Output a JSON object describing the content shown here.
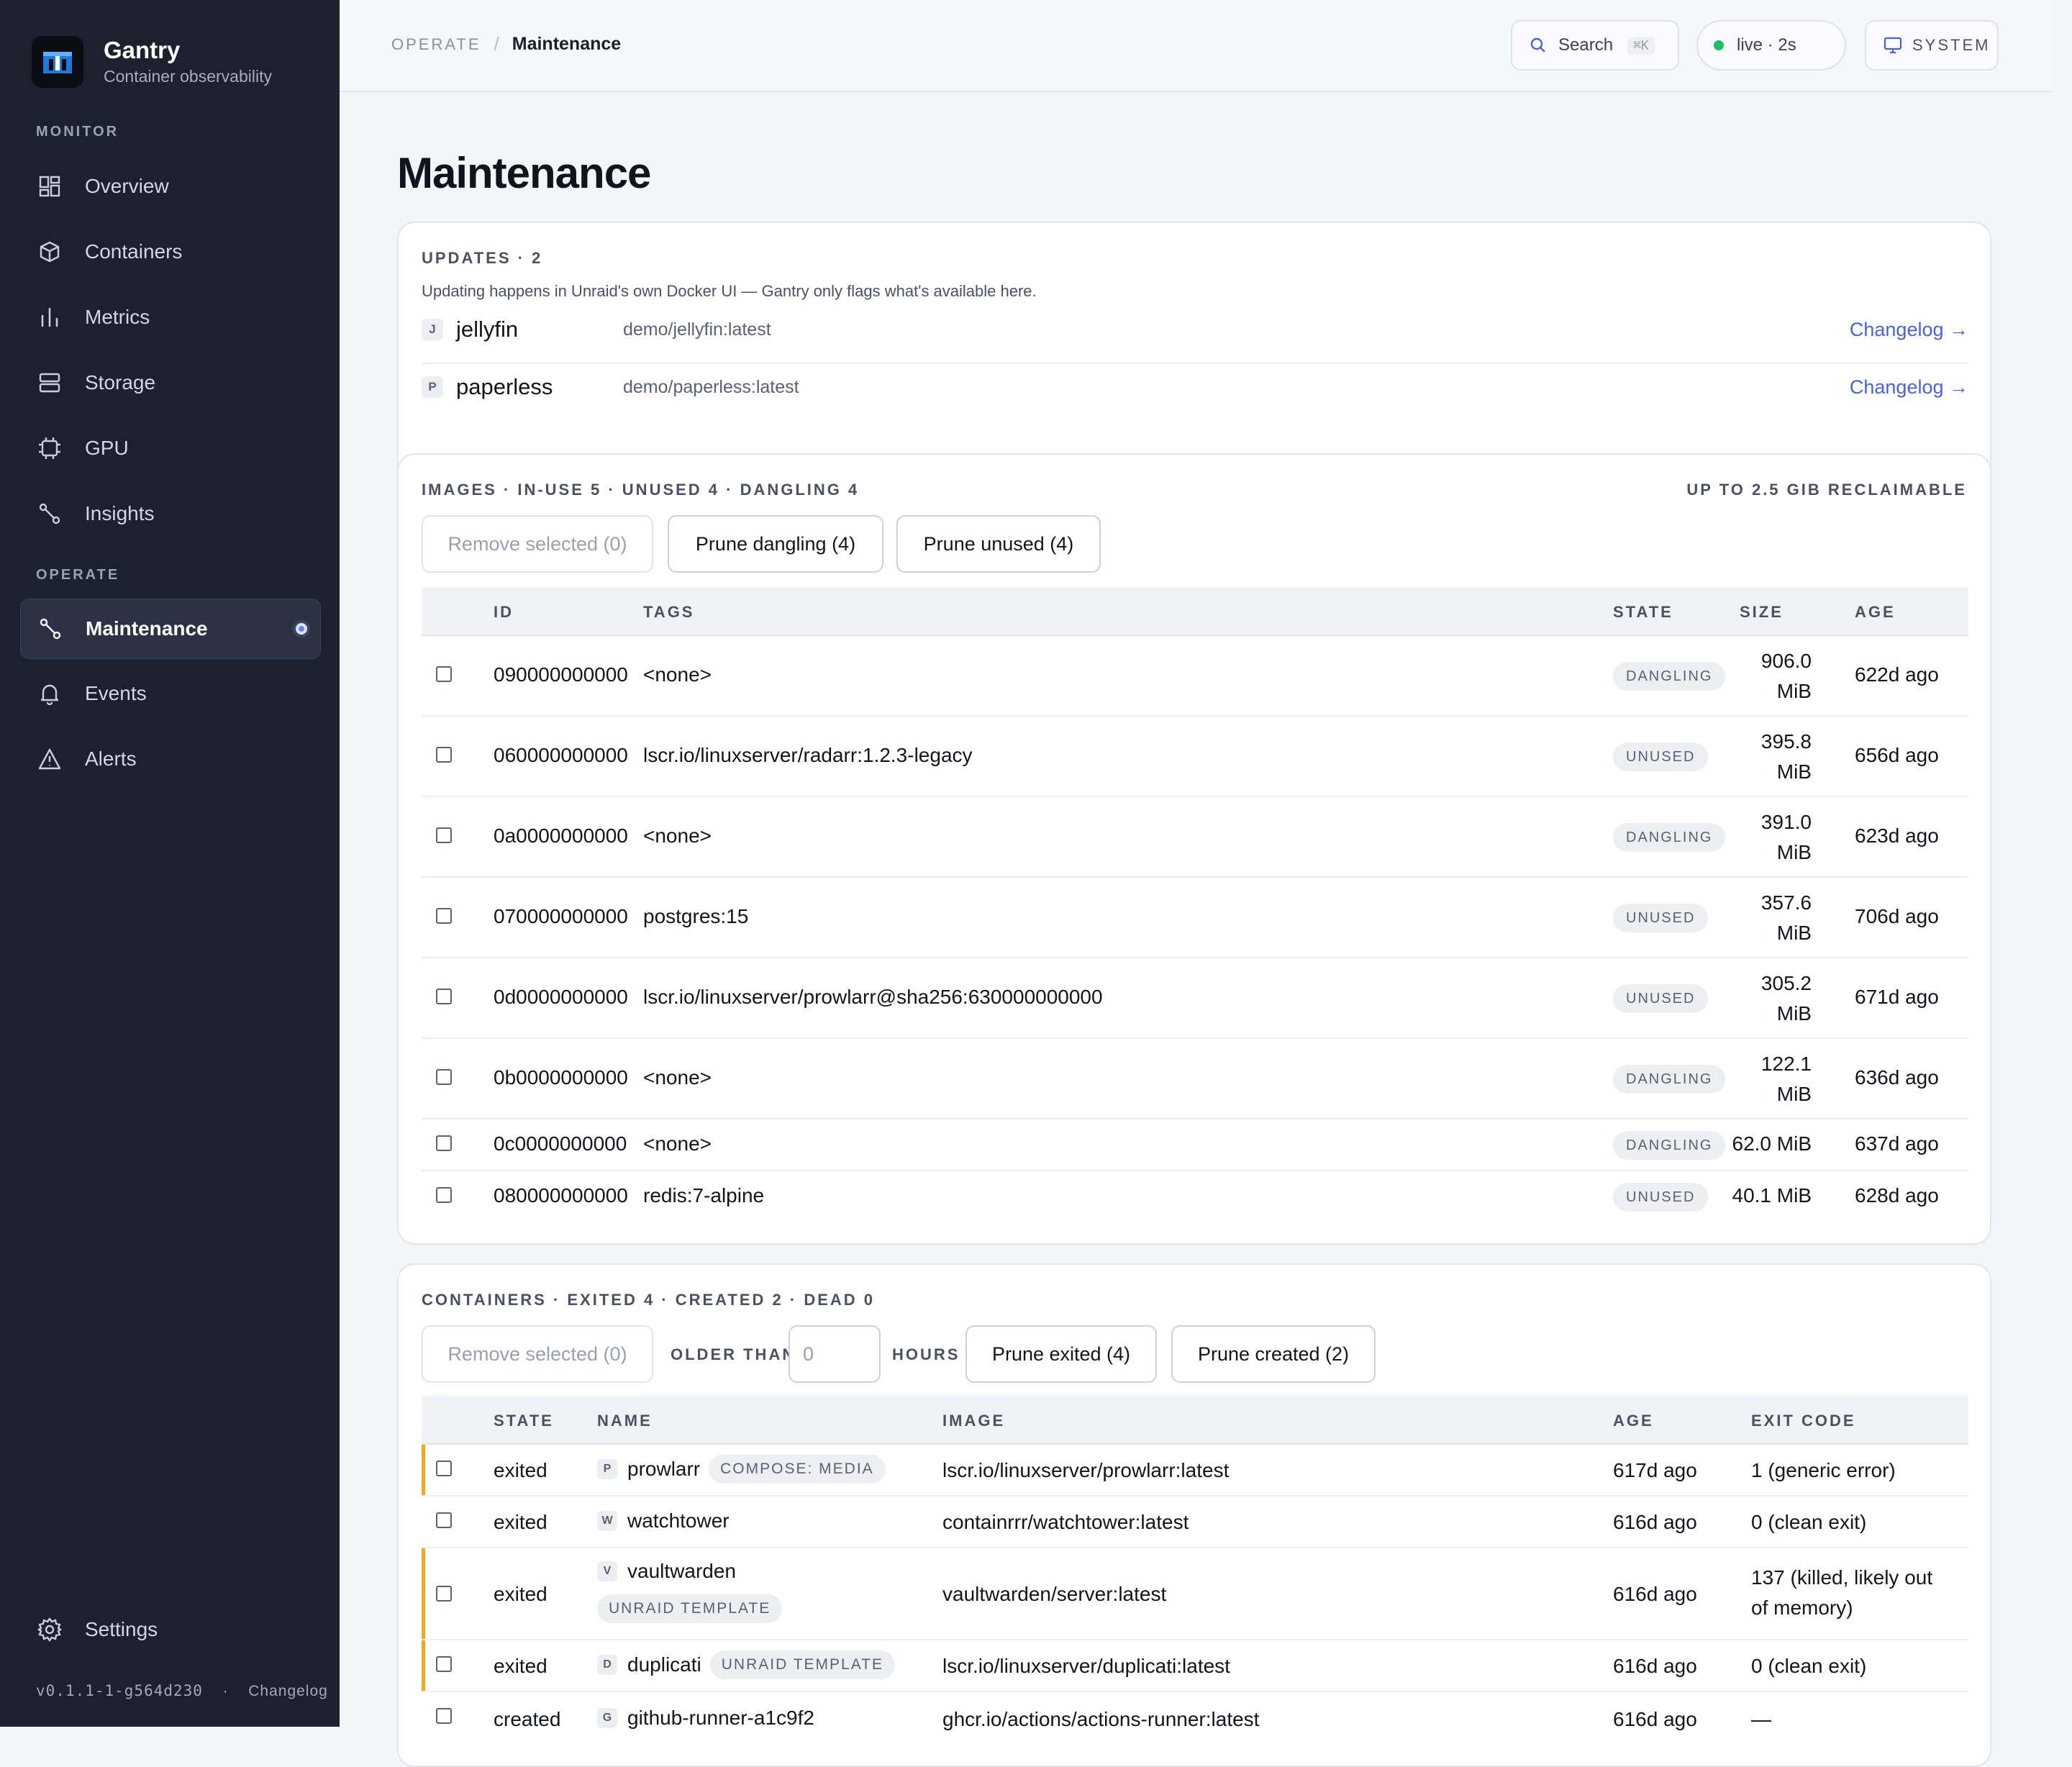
{
  "sidebar": {
    "brand_name": "Gantry",
    "brand_sub": "Container observability",
    "monitor_label": "MONITOR",
    "operate_label": "OPERATE",
    "items": [
      {
        "label": "Overview",
        "icon": "grid-icon"
      },
      {
        "label": "Containers",
        "icon": "cube-icon"
      },
      {
        "label": "Metrics",
        "icon": "bar-chart-icon"
      },
      {
        "label": "Storage",
        "icon": "storage-icon"
      },
      {
        "label": "GPU",
        "icon": "chip-icon"
      },
      {
        "label": "Insights",
        "icon": "route-icon"
      },
      {
        "label": "Maintenance",
        "icon": "route-icon",
        "active": true
      },
      {
        "label": "Events",
        "icon": "bell-icon"
      },
      {
        "label": "Alerts",
        "icon": "warning-icon"
      }
    ],
    "settings_label": "Settings",
    "version": "v0.1.1-1-g564d230",
    "footer_sep": "·",
    "footer_changelog": "Changelog"
  },
  "topbar": {
    "crumb_root": "OPERATE",
    "crumb_sep": "/",
    "crumb_current": "Maintenance",
    "search_label": "Search",
    "search_kbd": "⌘K",
    "live_label": "live · 2s",
    "system_label": "SYSTEM"
  },
  "page": {
    "title": "Maintenance"
  },
  "updates": {
    "heading": "UPDATES · 2",
    "note": "Updating happens in Unraid's own Docker UI — Gantry only flags what's available here.",
    "rows": [
      {
        "letter": "J",
        "name": "jellyfin",
        "image": "demo/jellyfin:latest",
        "link": "Changelog →"
      },
      {
        "letter": "P",
        "name": "paperless",
        "image": "demo/paperless:latest",
        "link": "Changelog →"
      }
    ]
  },
  "images": {
    "heading": "IMAGES · IN-USE 5 · UNUSED 4 · DANGLING 4",
    "reclaim": "UP TO 2.5 GIB RECLAIMABLE",
    "btn_remove": "Remove selected (0)",
    "btn_prune_dangling": "Prune dangling (4)",
    "btn_prune_unused": "Prune unused (4)",
    "columns": {
      "id": "ID",
      "tags": "TAGS",
      "state": "STATE",
      "size": "SIZE",
      "age": "AGE"
    },
    "rows": [
      {
        "id": "090000000000",
        "tags": "<none>",
        "state": "DANGLING",
        "size_a": "906.0",
        "size_b": "MiB",
        "age": "622d ago"
      },
      {
        "id": "060000000000",
        "tags": "lscr.io/linuxserver/radarr:1.2.3-legacy",
        "state": "UNUSED",
        "size_a": "395.8",
        "size_b": "MiB",
        "age": "656d ago"
      },
      {
        "id": "0a0000000000",
        "tags": "<none>",
        "state": "DANGLING",
        "size_a": "391.0",
        "size_b": "MiB",
        "age": "623d ago"
      },
      {
        "id": "070000000000",
        "tags": "postgres:15",
        "state": "UNUSED",
        "size_a": "357.6",
        "size_b": "MiB",
        "age": "706d ago"
      },
      {
        "id": "0d0000000000",
        "tags": "lscr.io/linuxserver/prowlarr@sha256:630000000000",
        "state": "UNUSED",
        "size_a": "305.2",
        "size_b": "MiB",
        "age": "671d ago"
      },
      {
        "id": "0b0000000000",
        "tags": "<none>",
        "state": "DANGLING",
        "size_a": "122.1",
        "size_b": "MiB",
        "age": "636d ago"
      },
      {
        "id": "0c0000000000",
        "tags": "<none>",
        "state": "DANGLING",
        "size_a": "62.0 MiB",
        "size_b": "",
        "age": "637d ago"
      },
      {
        "id": "080000000000",
        "tags": "redis:7-alpine",
        "state": "UNUSED",
        "size_a": "40.1 MiB",
        "size_b": "",
        "age": "628d ago"
      }
    ]
  },
  "containers": {
    "heading": "CONTAINERS · EXITED 4 · CREATED 2 · DEAD 0",
    "btn_remove": "Remove selected (0)",
    "older_than": "OLDER THAN",
    "hours_placeholder": "0",
    "hours": "HOURS",
    "btn_prune_exited": "Prune exited (4)",
    "btn_prune_created": "Prune created (2)",
    "columns": {
      "state": "STATE",
      "name": "NAME",
      "image": "IMAGE",
      "age": "AGE",
      "exit": "EXIT CODE"
    },
    "rows": [
      {
        "state": "exited",
        "letter": "P",
        "name": "prowlarr",
        "tag": "COMPOSE: MEDIA",
        "image": "lscr.io/linuxserver/prowlarr:latest",
        "age": "617d ago",
        "exit": "1 (generic error)"
      },
      {
        "state": "exited",
        "letter": "W",
        "name": "watchtower",
        "tag": "",
        "image": "containrrr/watchtower:latest",
        "age": "616d ago",
        "exit": "0 (clean exit)"
      },
      {
        "state": "exited",
        "letter": "V",
        "name": "vaultwarden",
        "tag": "UNRAID TEMPLATE",
        "image": "vaultwarden/server:latest",
        "age": "616d ago",
        "exit_a": "137 (killed, likely out",
        "exit_b": "of memory)"
      },
      {
        "state": "exited",
        "letter": "D",
        "name": "duplicati",
        "tag": "UNRAID TEMPLATE",
        "image": "lscr.io/linuxserver/duplicati:latest",
        "age": "616d ago",
        "exit": "0 (clean exit)"
      },
      {
        "state": "created",
        "letter": "G",
        "name": "github-runner-a1c9f2",
        "tag": "",
        "image": "ghcr.io/actions/actions-runner:latest",
        "age": "616d ago",
        "exit": "—"
      }
    ]
  },
  "colors": {
    "accent": "#4a62d8",
    "warning": "#f0a81c",
    "live": "#1fbf6a",
    "sidebar": "#1c2130"
  }
}
